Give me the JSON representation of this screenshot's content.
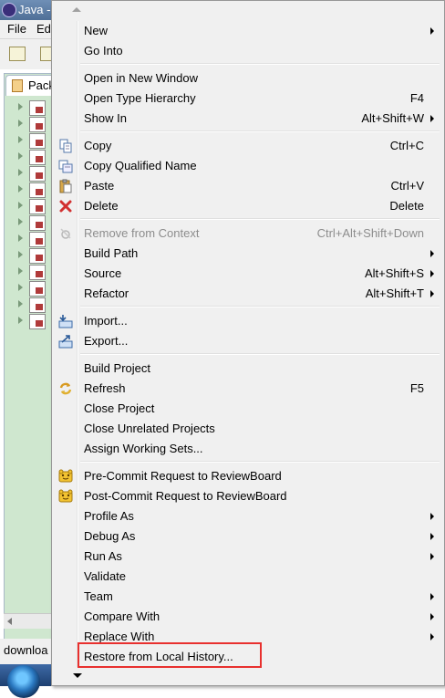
{
  "window": {
    "title": "Java -",
    "menu_file": "File",
    "menu_edit": "Ed"
  },
  "view": {
    "tab_label": "Pack"
  },
  "status": {
    "text": "downloa"
  },
  "menu": {
    "items": [
      {
        "label": "New",
        "shortcut": "",
        "submenu": true,
        "icon": "",
        "disabled": false
      },
      {
        "label": "Go Into",
        "shortcut": "",
        "submenu": false,
        "icon": "",
        "disabled": false
      },
      {
        "label": "Open in New Window",
        "shortcut": "",
        "submenu": false,
        "icon": "",
        "disabled": false
      },
      {
        "label": "Open Type Hierarchy",
        "shortcut": "F4",
        "submenu": false,
        "icon": "",
        "disabled": false
      },
      {
        "label": "Show In",
        "shortcut": "Alt+Shift+W",
        "submenu": true,
        "icon": "",
        "disabled": false
      },
      {
        "label": "Copy",
        "shortcut": "Ctrl+C",
        "submenu": false,
        "icon": "copy-icon",
        "disabled": false
      },
      {
        "label": "Copy Qualified Name",
        "shortcut": "",
        "submenu": false,
        "icon": "copy-qualified-name-icon",
        "disabled": false
      },
      {
        "label": "Paste",
        "shortcut": "Ctrl+V",
        "submenu": false,
        "icon": "paste-icon",
        "disabled": false
      },
      {
        "label": "Delete",
        "shortcut": "Delete",
        "submenu": false,
        "icon": "delete-icon",
        "disabled": false
      },
      {
        "label": "Remove from Context",
        "shortcut": "Ctrl+Alt+Shift+Down",
        "submenu": false,
        "icon": "remove-context-icon",
        "disabled": true
      },
      {
        "label": "Build Path",
        "shortcut": "",
        "submenu": true,
        "icon": "",
        "disabled": false
      },
      {
        "label": "Source",
        "shortcut": "Alt+Shift+S",
        "submenu": true,
        "icon": "",
        "disabled": false
      },
      {
        "label": "Refactor",
        "shortcut": "Alt+Shift+T",
        "submenu": true,
        "icon": "",
        "disabled": false
      },
      {
        "label": "Import...",
        "shortcut": "",
        "submenu": false,
        "icon": "import-icon",
        "disabled": false
      },
      {
        "label": "Export...",
        "shortcut": "",
        "submenu": false,
        "icon": "export-icon",
        "disabled": false
      },
      {
        "label": "Build Project",
        "shortcut": "",
        "submenu": false,
        "icon": "",
        "disabled": false
      },
      {
        "label": "Refresh",
        "shortcut": "F5",
        "submenu": false,
        "icon": "refresh-icon",
        "disabled": false
      },
      {
        "label": "Close Project",
        "shortcut": "",
        "submenu": false,
        "icon": "",
        "disabled": false
      },
      {
        "label": "Close Unrelated Projects",
        "shortcut": "",
        "submenu": false,
        "icon": "",
        "disabled": false
      },
      {
        "label": "Assign Working Sets...",
        "shortcut": "",
        "submenu": false,
        "icon": "",
        "disabled": false
      },
      {
        "label": "Pre-Commit Request to ReviewBoard",
        "shortcut": "",
        "submenu": false,
        "icon": "reviewboard-icon",
        "disabled": false
      },
      {
        "label": "Post-Commit Request to ReviewBoard",
        "shortcut": "",
        "submenu": false,
        "icon": "reviewboard-icon",
        "disabled": false
      },
      {
        "label": "Profile As",
        "shortcut": "",
        "submenu": true,
        "icon": "",
        "disabled": false
      },
      {
        "label": "Debug As",
        "shortcut": "",
        "submenu": true,
        "icon": "",
        "disabled": false
      },
      {
        "label": "Run As",
        "shortcut": "",
        "submenu": true,
        "icon": "",
        "disabled": false
      },
      {
        "label": "Validate",
        "shortcut": "",
        "submenu": false,
        "icon": "",
        "disabled": false
      },
      {
        "label": "Team",
        "shortcut": "",
        "submenu": true,
        "icon": "",
        "disabled": false
      },
      {
        "label": "Compare With",
        "shortcut": "",
        "submenu": true,
        "icon": "",
        "disabled": false
      },
      {
        "label": "Replace With",
        "shortcut": "",
        "submenu": true,
        "icon": "",
        "disabled": false
      },
      {
        "label": "Restore from Local History...",
        "shortcut": "",
        "submenu": false,
        "icon": "",
        "disabled": false
      }
    ]
  },
  "colors": {
    "menu_bg": "#f0f0f0",
    "highlight_border": "#e8302e",
    "view_bg": "#cfe7cf"
  }
}
